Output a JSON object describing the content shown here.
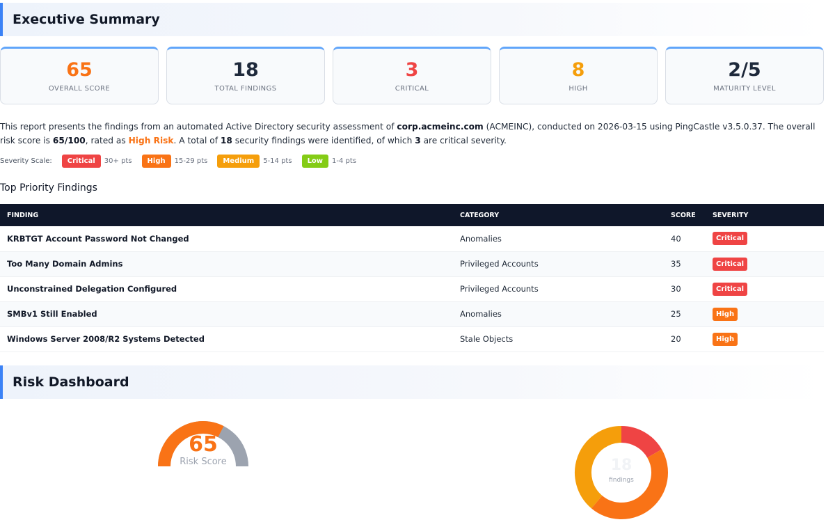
{
  "exec_title": "Executive Summary",
  "cards": [
    {
      "value": "65",
      "label": "Overall Score",
      "color": "#f97316"
    },
    {
      "value": "18",
      "label": "Total Findings",
      "color": "#1e293b"
    },
    {
      "value": "3",
      "label": "Critical",
      "color": "#ef4444"
    },
    {
      "value": "8",
      "label": "High",
      "color": "#f59e0b"
    },
    {
      "value": "2/5",
      "label": "Maturity Level",
      "color": "#1e293b"
    }
  ],
  "intro": {
    "p1": "This report presents the findings from an automated Active Directory security assessment of ",
    "domain": "corp.acmeinc.com",
    "p2": " (ACMEINC), conducted on 2026-03-15 using PingCastle v3.5.0.37. The overall risk score is ",
    "score": "65/100",
    "p3": ", rated as ",
    "risk": "High Risk",
    "p4": ". A total of ",
    "total": "18",
    "p5": " security findings were identified, of which ",
    "critical": "3",
    "p6": " are critical severity."
  },
  "severity_scale": {
    "title": "Severity Scale:",
    "items": [
      {
        "label": "Critical",
        "pts": "30+ pts",
        "color": "#ef4444"
      },
      {
        "label": "High",
        "pts": "15-29 pts",
        "color": "#f97316"
      },
      {
        "label": "Medium",
        "pts": "5-14 pts",
        "color": "#f59e0b"
      },
      {
        "label": "Low",
        "pts": "1-4 pts",
        "color": "#84cc16"
      }
    ]
  },
  "priority_title": "Top Priority Findings",
  "table": {
    "headers": [
      "Finding",
      "Category",
      "Score",
      "Severity"
    ],
    "rows": [
      {
        "finding": "KRBTGT Account Password Not Changed",
        "category": "Anomalies",
        "score": "40",
        "severity": "Critical",
        "color": "#ef4444"
      },
      {
        "finding": "Too Many Domain Admins",
        "category": "Privileged Accounts",
        "score": "35",
        "severity": "Critical",
        "color": "#ef4444"
      },
      {
        "finding": "Unconstrained Delegation Configured",
        "category": "Privileged Accounts",
        "score": "30",
        "severity": "Critical",
        "color": "#ef4444"
      },
      {
        "finding": "SMBv1 Still Enabled",
        "category": "Anomalies",
        "score": "25",
        "severity": "High",
        "color": "#f97316"
      },
      {
        "finding": "Windows Server 2008/R2 Systems Detected",
        "category": "Stale Objects",
        "score": "20",
        "severity": "High",
        "color": "#f97316"
      }
    ]
  },
  "risk_title": "Risk Dashboard",
  "gauge": {
    "value": 65,
    "max": 100,
    "number": "65",
    "label": "Risk Score",
    "fill_color": "#f97316",
    "track_color": "#9ca3af"
  },
  "donut": {
    "center": "18",
    "label": "findings",
    "segments": [
      {
        "name": "Critical",
        "value": 3,
        "color": "#ef4444"
      },
      {
        "name": "High",
        "value": 8,
        "color": "#f97316"
      },
      {
        "name": "Medium",
        "value": 7,
        "color": "#f59e0b"
      }
    ]
  }
}
